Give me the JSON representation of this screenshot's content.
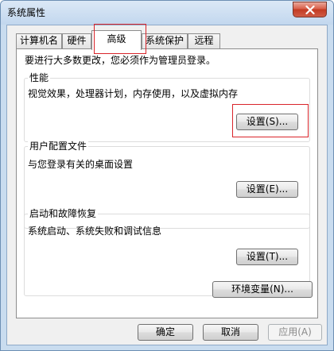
{
  "window": {
    "title": "系统属性",
    "accent_color": "#d9242a"
  },
  "tabs": [
    {
      "label": "计算机名",
      "active": false
    },
    {
      "label": "硬件",
      "active": false
    },
    {
      "label": "高级",
      "active": true
    },
    {
      "label": "系统保护",
      "active": false
    },
    {
      "label": "远程",
      "active": false
    }
  ],
  "panel": {
    "admin_notice": "要进行大多数更改，您必须作为管理员登录。",
    "performance": {
      "title": "性能",
      "description": "视觉效果，处理器计划，内存使用，以及虚拟内存",
      "settings_button": "设置(S)..."
    },
    "user_profiles": {
      "title": "用户配置文件",
      "description": "与您登录有关的桌面设置",
      "settings_button": "设置(E)..."
    },
    "startup_recovery": {
      "title": "启动和故障恢复",
      "description": "系统启动、系统失败和调试信息",
      "settings_button": "设置(T)..."
    },
    "env_button": "环境变量(N)..."
  },
  "footer": {
    "ok": "确定",
    "cancel": "取消",
    "apply": "应用(A)"
  }
}
